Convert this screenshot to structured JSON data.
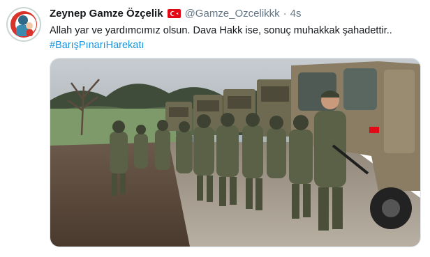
{
  "tweet": {
    "display_name": "Zeynep Gamze Özçelik",
    "handle": "@Gamze_Ozcelikkk",
    "separator": "·",
    "time": "4s",
    "text": "Allah yar ve yardımcımız olsun. Dava Hakk ise, sonuç muhakkak şahadettir..",
    "hashtag": "#BarışPınarıHarekatı",
    "icons": {
      "avatar": "profile-avatar",
      "flag": "turkey-flag-icon"
    },
    "colors": {
      "name": "#14171a",
      "muted": "#657786",
      "hashtag": "#1b95e0",
      "flag_red": "#e30a17"
    }
  },
  "media": {
    "description_icon": "photo-soldiers-marching"
  }
}
